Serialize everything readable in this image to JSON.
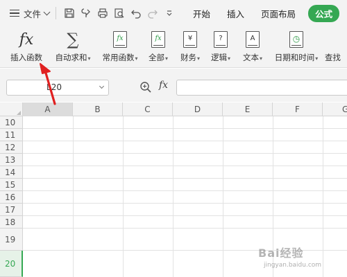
{
  "menu": {
    "file_label": "文件",
    "tabs": [
      {
        "label": "开始"
      },
      {
        "label": "插入"
      },
      {
        "label": "页面布局"
      },
      {
        "label": "公式",
        "active": true
      }
    ],
    "quick_access_icons": [
      "save-icon",
      "format-painter-icon",
      "print-icon",
      "print-preview-icon",
      "undo-icon",
      "redo-icon",
      "customize-dropdown-icon"
    ],
    "active_color": "#35a853"
  },
  "ribbon": {
    "buttons": [
      {
        "label": "插入函数",
        "icon": "fx-icon",
        "dropdown": false
      },
      {
        "label": "自动求和",
        "icon": "sigma-icon",
        "dropdown": true
      },
      {
        "label": "常用函数",
        "icon": "common-function-icon",
        "dropdown": true,
        "glyph": "fx"
      },
      {
        "label": "全部",
        "icon": "all-functions-icon",
        "dropdown": true,
        "glyph": "fx"
      },
      {
        "label": "财务",
        "icon": "finance-icon",
        "dropdown": true,
        "glyph": "¥"
      },
      {
        "label": "逻辑",
        "icon": "logic-icon",
        "dropdown": true,
        "glyph": "?"
      },
      {
        "label": "文本",
        "icon": "text-icon",
        "dropdown": true,
        "glyph": "A"
      },
      {
        "label": "日期和时间",
        "icon": "date-time-icon",
        "dropdown": true,
        "glyph": "◷"
      },
      {
        "label": "查找",
        "icon": "lookup-icon",
        "dropdown": false
      }
    ]
  },
  "formula_bar": {
    "name_box_value": "L20",
    "fx_label": "fx",
    "formula_value": ""
  },
  "grid": {
    "columns": [
      "A",
      "B",
      "C",
      "D",
      "E",
      "F",
      "G"
    ],
    "rows": [
      "10",
      "11",
      "12",
      "13",
      "14",
      "15",
      "16",
      "17",
      "18",
      "19",
      "20"
    ],
    "active_row": "20"
  },
  "watermark": {
    "brand": "Bai经验",
    "url": "jingyan.baidu.com"
  }
}
